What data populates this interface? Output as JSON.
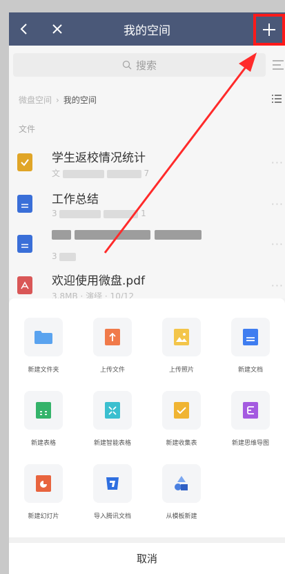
{
  "header": {
    "title": "我的空间",
    "add_label": "+"
  },
  "search": {
    "placeholder": "搜索"
  },
  "breadcrumb": {
    "root": "微盘空间",
    "current": "我的空间"
  },
  "section": {
    "label": "文件"
  },
  "files": [
    {
      "name": "学生返校情况统计",
      "meta_prefix": "文",
      "meta_suffix": "7",
      "icon": "form-icon",
      "color": "#e0a527"
    },
    {
      "name": "工作总结",
      "meta_prefix": "3",
      "meta_suffix": "1",
      "icon": "doc-icon",
      "color": "#3a6fd8"
    },
    {
      "name": "",
      "meta_prefix": "3",
      "meta_suffix": "",
      "icon": "doc-icon",
      "color": "#3a6fd8"
    },
    {
      "name": "欢迎使用微盘.pdf",
      "meta": "3.8MB · 演绎 · 10/12",
      "icon": "pdf-icon",
      "color": "#d95757"
    }
  ],
  "actions": [
    {
      "label": "新建文件夹",
      "icon": "folder-icon",
      "color": "#5aa3ef"
    },
    {
      "label": "上传文件",
      "icon": "upload-icon",
      "color": "#f07a4a"
    },
    {
      "label": "上传照片",
      "icon": "photo-icon",
      "color": "#f3c54a"
    },
    {
      "label": "新建文档",
      "icon": "doc-icon",
      "color": "#3f7df0"
    },
    {
      "label": "新建表格",
      "icon": "sheet-icon",
      "color": "#34b36a"
    },
    {
      "label": "新建智能表格",
      "icon": "smart-sheet-icon",
      "color": "#3bbfcf"
    },
    {
      "label": "新建收集表",
      "icon": "collect-form-icon",
      "color": "#f0b433"
    },
    {
      "label": "新建思维导图",
      "icon": "mindmap-icon",
      "color": "#a45ae0"
    },
    {
      "label": "新建幻灯片",
      "icon": "slides-icon",
      "color": "#e8643e"
    },
    {
      "label": "导入腾讯文档",
      "icon": "import-icon",
      "color": "#2f6fe0"
    },
    {
      "label": "从模板新建",
      "icon": "template-icon",
      "color": "#4a7fe0"
    }
  ],
  "cancel_label": "取消",
  "colors": {
    "header": "#4a5878",
    "highlight": "#ff1a1a"
  }
}
